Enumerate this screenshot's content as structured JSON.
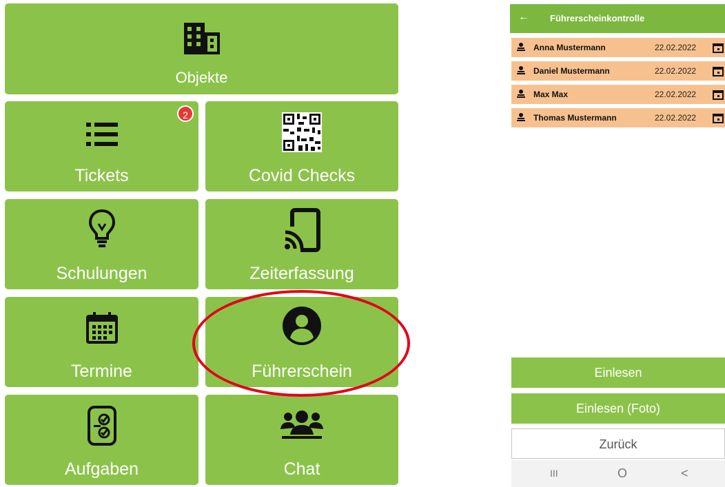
{
  "menu": {
    "objekte": "Objekte",
    "tickets": "Tickets",
    "tickets_badge": "2",
    "covid": "Covid Checks",
    "schulungen": "Schulungen",
    "zeiterfassung": "Zeiterfassung",
    "termine": "Termine",
    "fuehrerschein": "Führerschein",
    "aufgaben": "Aufgaben",
    "chat": "Chat"
  },
  "detail": {
    "back_icon": "←",
    "title": "Führerscheinkontrolle",
    "entries": [
      {
        "name": "Anna Mustermann",
        "date": "22.02.2022"
      },
      {
        "name": "Daniel Mustermann",
        "date": "22.02.2022"
      },
      {
        "name": "Max Max",
        "date": "22.02.2022"
      },
      {
        "name": "Thomas Mustermann",
        "date": "22.02.2022"
      }
    ],
    "btn_einlesen": "Einlesen",
    "btn_einlesen_foto": "Einlesen (Foto)",
    "btn_zurueck": "Zurück",
    "nav": {
      "recents": "III",
      "home": "O",
      "back": "<"
    }
  },
  "colors": {
    "tile_green": "#8bc34a",
    "appbar_green": "#7cb83f",
    "row_peach": "#f7c18f",
    "highlight_red": "#e3001b",
    "badge_red": "#e53935"
  }
}
